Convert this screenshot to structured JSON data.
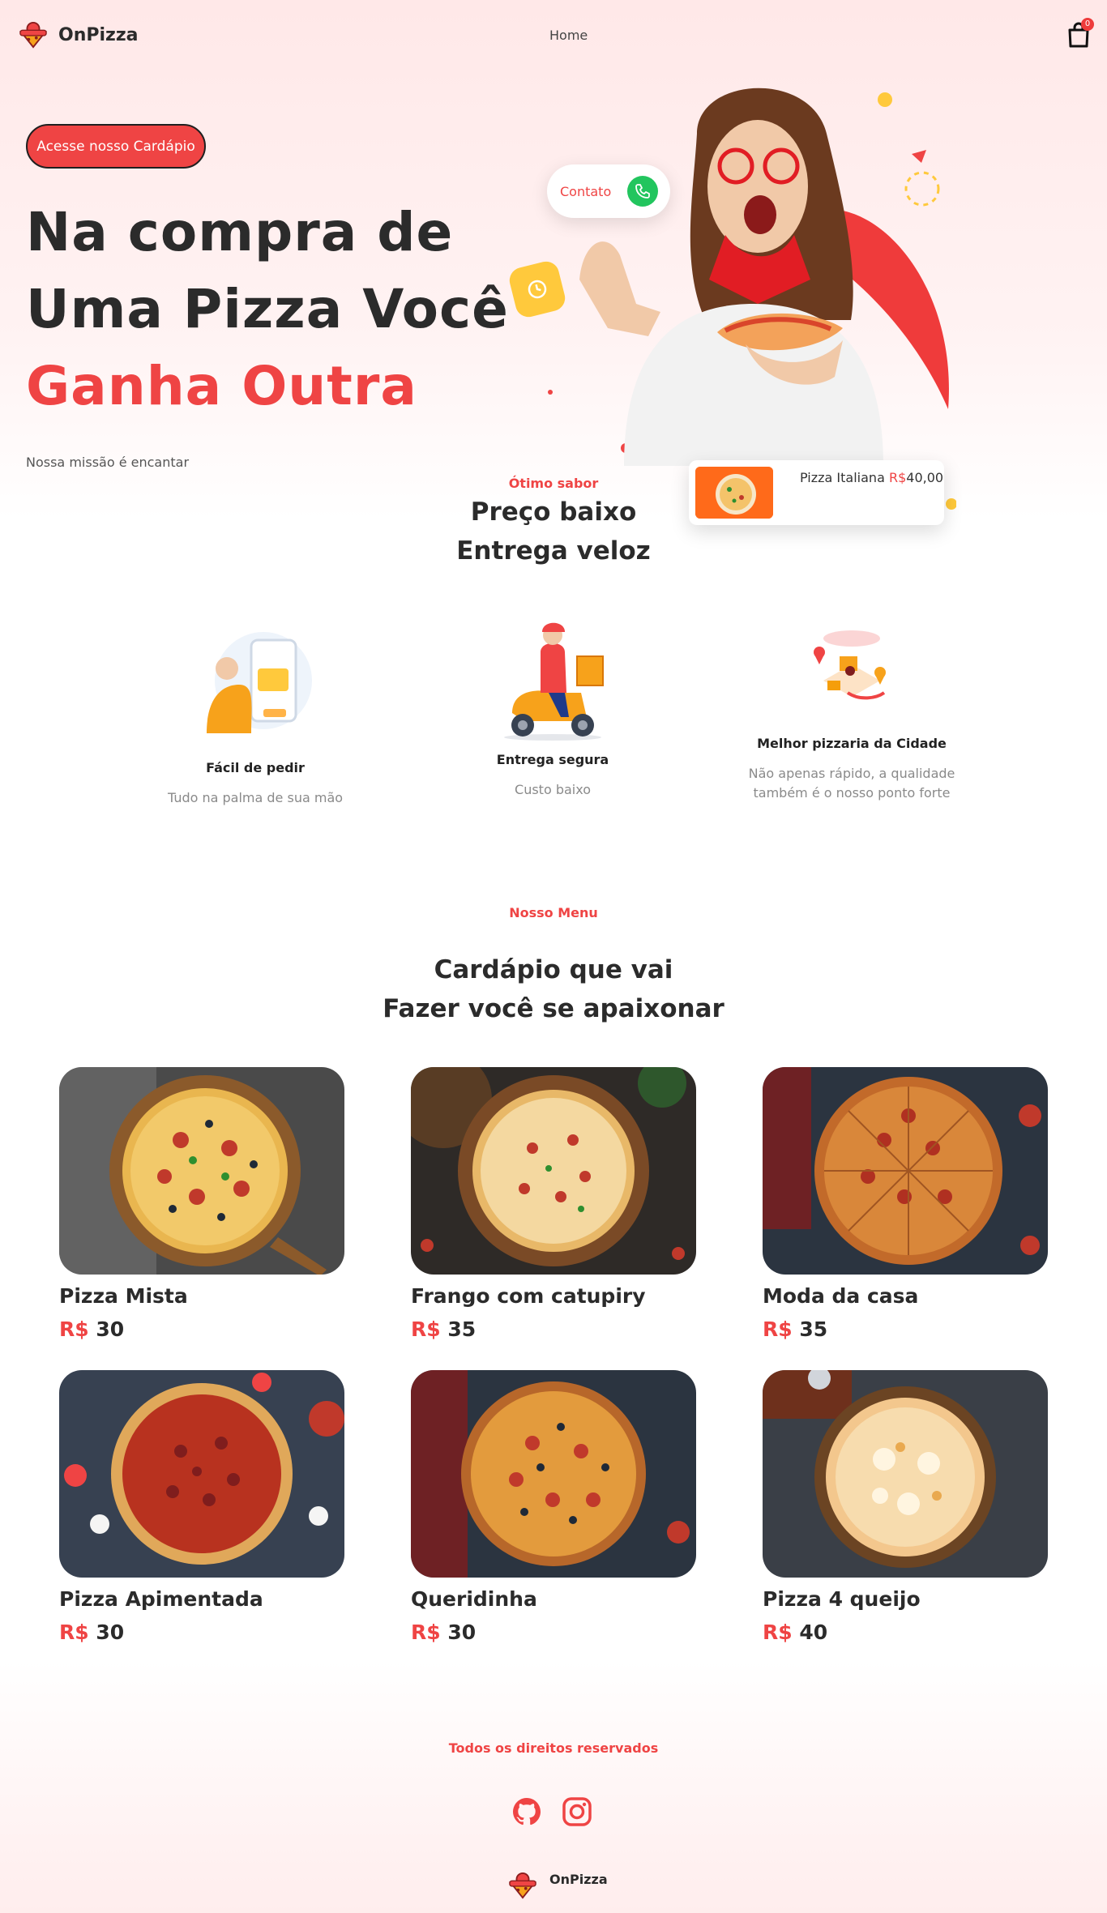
{
  "header": {
    "brand": "OnPizza",
    "nav_home": "Home",
    "cart_count": "0"
  },
  "hero": {
    "cta": "Acesse nosso Cardápio",
    "line1": "Na compra de",
    "line2": "Uma Pizza Você",
    "line3": "Ganha Outra",
    "mission": "Nossa missão é encantar",
    "contact_label": "Contato",
    "order_card": {
      "name": "Pizza Italiana",
      "currency": "R$",
      "amount": "40,00"
    }
  },
  "features": {
    "eyebrow": "Ótimo sabor",
    "title_line1": "Preço baixo",
    "title_line2": "Entrega veloz",
    "items": [
      {
        "title": "Fácil de pedir",
        "desc": "Tudo na palma de sua mão"
      },
      {
        "title": "Entrega segura",
        "desc": "Custo baixo"
      },
      {
        "title": "Melhor pizzaria da Cidade",
        "desc": "Não apenas rápido, a qualidade também é o nosso ponto forte"
      }
    ]
  },
  "menu": {
    "eyebrow": "Nosso Menu",
    "title_line1": "Cardápio que vai",
    "title_line2": "Fazer você se apaixonar",
    "currency": "R$",
    "items": [
      {
        "name": "Pizza Mista",
        "price": "30"
      },
      {
        "name": "Frango com catupiry",
        "price": "35"
      },
      {
        "name": "Moda da casa",
        "price": "35"
      },
      {
        "name": "Pizza Apimentada",
        "price": "30"
      },
      {
        "name": "Queridinha",
        "price": "30"
      },
      {
        "name": "Pizza 4 queijo",
        "price": "40"
      }
    ]
  },
  "footer": {
    "rights": "Todos os direitos reservados",
    "brand": "OnPizza",
    "social_icons": [
      "github-icon",
      "instagram-icon"
    ]
  },
  "colors": {
    "accent": "#ef4444",
    "text": "#2b2b2b",
    "muted": "#8a8a8a",
    "yellow": "#ffc93c",
    "green": "#22c55e"
  }
}
